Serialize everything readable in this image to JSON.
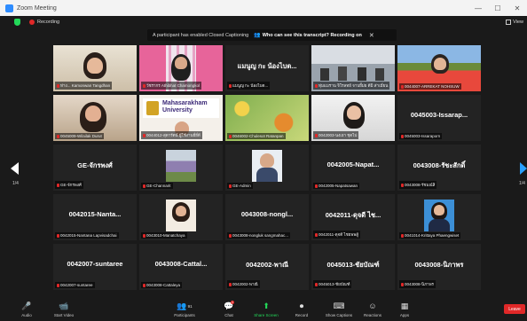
{
  "window": {
    "title": "Zoom Meeting",
    "controls": [
      "—",
      "☐",
      "✕"
    ]
  },
  "topbar": {
    "recording_label": "Recording",
    "view_label": "View"
  },
  "caption_banner": {
    "message": "A participant has enabled Closed Captioning",
    "link": "Who can see this transcript? Recording on",
    "close": "✕"
  },
  "pagination": {
    "left": "1/4",
    "right": "1/4"
  },
  "tiles": [
    {
      "label": "ห่าง... Kamonwan Tangdhan",
      "big": "",
      "active": true
    },
    {
      "label": "วัชรากร Athibhat Chamongkol",
      "big": ""
    },
    {
      "label": "แมนูญ กะ น้องไบต...",
      "big": "แมนูญ กะ น้องไบต..."
    },
    {
      "label": "ทุ่มแมราน จิโรลทย์ จาบยี้ม่ย ดีมิ ส่าเมี่ยน",
      "big": ""
    },
    {
      "label": "0044007-ARREKAT NOHSUW",
      "big": ""
    },
    {
      "label": "0045009-Wilailak Durut",
      "big": ""
    },
    {
      "label": "0044012-สุดารัตน์ ผู้ใช้งานยี่ยี่ดี",
      "big": ""
    },
    {
      "label": "0046002-Chulesot Ratanpan",
      "big": ""
    },
    {
      "label": "0042003-นงเยา ชุดไป",
      "big": ""
    },
    {
      "label": "0045003-Issaraporn",
      "big": "0045003-Issarap..."
    },
    {
      "label": "GE-จักรพงศ์",
      "big": "GE-จักรพงศ์"
    },
    {
      "label": "GE-Channarit",
      "big": ""
    },
    {
      "label": "GE-Admin",
      "big": ""
    },
    {
      "label": "0042005-Napatsawan",
      "big": "0042005-Napat..."
    },
    {
      "label": "0043008-รัชมณ์สิ",
      "big": "0043008-รัชะสักดิ์"
    },
    {
      "label": "0042015-Nantana Lapvisadchai",
      "big": "0042015-Nanta..."
    },
    {
      "label": "0043010-Manatchaya",
      "big": ""
    },
    {
      "label": "0043008-nongluk sangmahac...",
      "big": "0043008-nongl..."
    },
    {
      "label": "0042011-ดุจดี ไชยพพสู้",
      "big": "0042011-ดุจดี ไช..."
    },
    {
      "label": "0041014-Krittaya Phaengwiset",
      "big": ""
    },
    {
      "label": "0042007-suntaree",
      "big": "0042007-suntaree"
    },
    {
      "label": "0043008-Cattaleya",
      "big": "0043008-Cattal..."
    },
    {
      "label": "0042002-พาณี",
      "big": "0042002-พาณี"
    },
    {
      "label": "0045013-ชัยบัณฑ์",
      "big": "0045013-ชัยบัณฑ์"
    },
    {
      "label": "0043008-นิภาพร",
      "big": "0043008-นิภาพร"
    }
  ],
  "university_banner": {
    "line1": "Mahasarakham",
    "line2": "University"
  },
  "toolbar": {
    "audio": "Audio",
    "video": "Start Video",
    "participants": "Participants",
    "participants_count": "91",
    "chat": "Chat",
    "chat_badge": "1",
    "share": "Share Screen",
    "record": "Record",
    "captions": "Show Captions",
    "reactions": "Reactions",
    "apps": "Apps",
    "leave": "Leave"
  },
  "colors": {
    "accent_blue": "#2d8cff",
    "share_green": "#23d959",
    "leave_red": "#e02828",
    "active_outline": "#f0e040"
  }
}
